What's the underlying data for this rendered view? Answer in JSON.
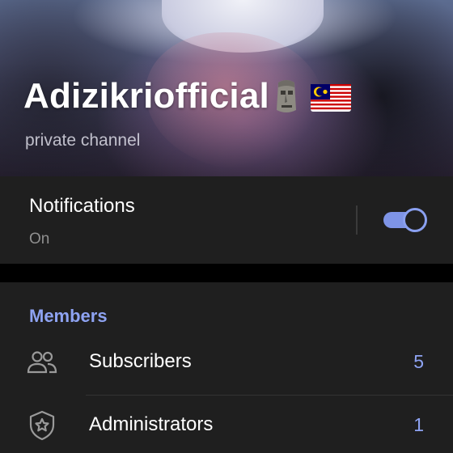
{
  "header": {
    "title": "Adizikriofficial",
    "subtitle": "private channel",
    "title_emojis": [
      "moai-emoji-icon",
      "malaysia-flag-icon"
    ]
  },
  "notifications": {
    "label": "Notifications",
    "status": "On",
    "enabled": true,
    "accent": "#7e94e6"
  },
  "members": {
    "section_title": "Members",
    "rows": [
      {
        "label": "Subscribers",
        "count": "5",
        "icon": "subscribers-icon"
      },
      {
        "label": "Administrators",
        "count": "1",
        "icon": "admin-shield-icon"
      }
    ]
  }
}
